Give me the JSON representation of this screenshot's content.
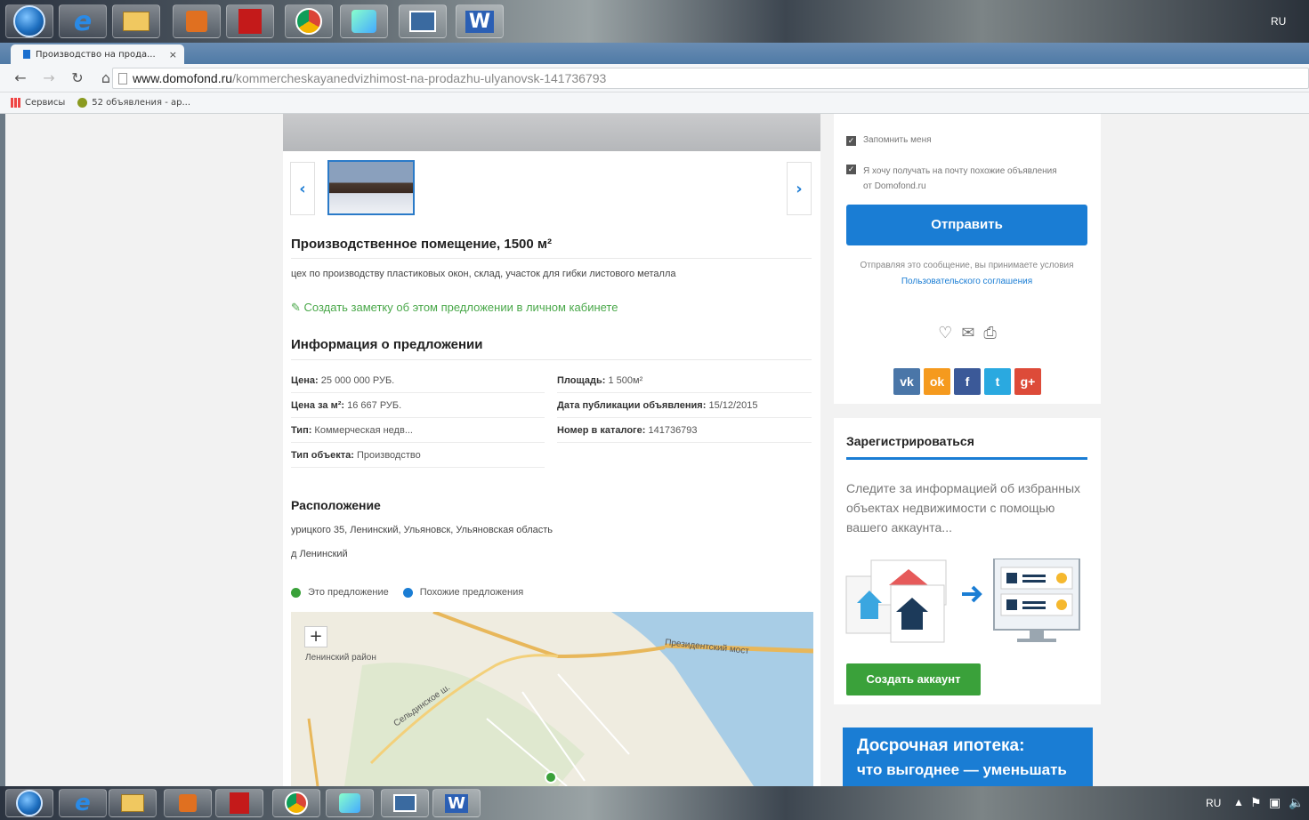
{
  "taskbar": {
    "ie_glyph": "e",
    "word_glyph": "W",
    "top_tray_lang": "RU",
    "bottom_tray_lang": "RU"
  },
  "browser": {
    "tab_title": "Производство на прода...",
    "tab_close": "×",
    "url_domain": "www.domofond.ru",
    "url_path": "/kommercheskayanedvizhimost-na-prodazhu-ulyanovsk-141736793",
    "bookmarks": [
      "Сервисы",
      "52 объявления - ар..."
    ]
  },
  "listing": {
    "title": "Производственное помещение, 1500 м²",
    "description": "цех по производству пластиковых окон, склад, участок для гибки листового металла",
    "note_link": "Создать заметку об этом предложении в личном кабинете",
    "info_heading": "Информация о предложении",
    "info": {
      "price_label": "Цена:",
      "price_value": " 25 000 000 РУБ.",
      "area_label": "Площадь:",
      "area_value": " 1 500м²",
      "ppsm_label": "Цена за м²:",
      "ppsm_value": " 16 667 РУБ.",
      "date_label": "Дата публикации объявления:",
      "date_value": " 15/12/2015",
      "type_label": "Тип:",
      "type_value": " Коммерческая недв...",
      "catalog_label": "Номер в каталоге:",
      "catalog_value": " 141736793",
      "objtype_label": "Тип объекта:",
      "objtype_value": " Производство"
    },
    "location_heading": "Расположение",
    "address": "урицкого 35, Ленинский, Ульяновск, Ульяновская область",
    "district": "д Ленинский",
    "legend": {
      "this": "Это предложение",
      "similar": "Похожие предложения"
    },
    "map_labels": {
      "district": "Ленинский район",
      "bridge": "Президентский мост",
      "street": "Сельдинское ш."
    }
  },
  "sidebar": {
    "remember_me": "Запомнить меня",
    "subscribe": "Я хочу получать на почту похожие объявления от Domofond.ru",
    "send_button": "Отправить",
    "terms_text": "Отправляя это сообщение, вы принимаете условия ",
    "terms_link": "Пользовательского соглашения",
    "social": [
      "vk",
      "ok",
      "f",
      "t",
      "g+"
    ],
    "register_title": "Зарегистрироваться",
    "register_text": "Следите за информацией об избранных объектах недвижимости с помощью вашего аккаунта...",
    "create_button": "Создать аккаунт",
    "promo_line1": "Досрочная ипотека:",
    "promo_line2": "что выгоднее — уменьшать"
  },
  "colors": {
    "accent": "#1a7dd4",
    "green": "#3aa13a",
    "link_green": "#4aa84a"
  }
}
